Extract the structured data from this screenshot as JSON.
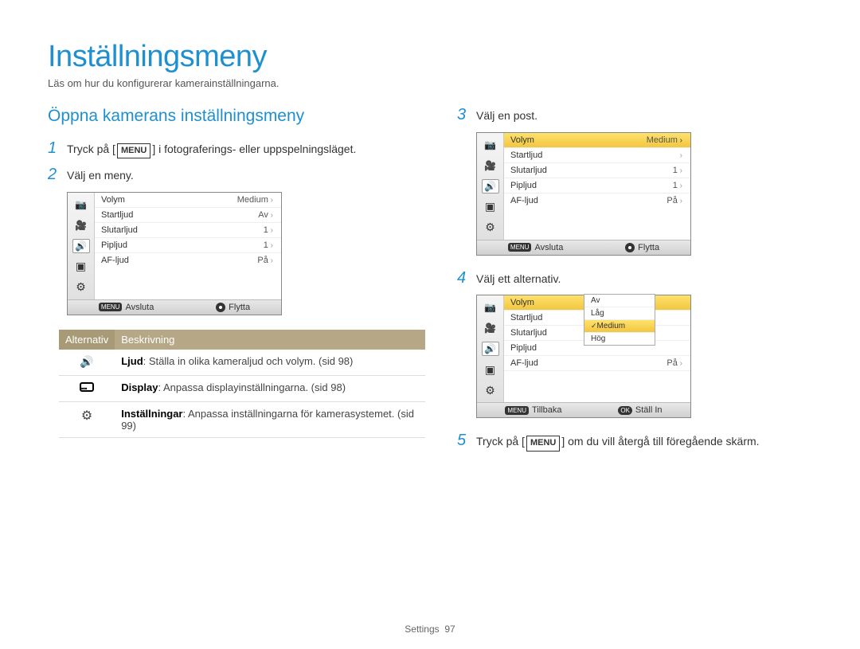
{
  "page": {
    "title": "Inställningsmeny",
    "subtitle": "Läs om hur du konfigurerar kamerainställningarna."
  },
  "section": {
    "heading": "Öppna kamerans inställningsmeny"
  },
  "steps": {
    "s1_pre": "Tryck på [",
    "s1_menu": "MENU",
    "s1_post": "] i fotograferings- eller uppspelningsläget.",
    "s2": "Välj en meny.",
    "s3": "Välj en post.",
    "s4": "Välj ett alternativ.",
    "s5_pre": "Tryck på [",
    "s5_menu": "MENU",
    "s5_post": "] om du vill återgå till föregående skärm."
  },
  "nums": {
    "n1": "1",
    "n2": "2",
    "n3": "3",
    "n4": "4",
    "n5": "5"
  },
  "lcd": {
    "rows": {
      "volym": "Volym",
      "startljud": "Startljud",
      "slutarljud": "Slutarljud",
      "pipljud": "Pipljud",
      "afljud": "AF-ljud"
    },
    "vals2": {
      "volym": "Medium",
      "startljud": "Av",
      "slutarljud": "1",
      "pipljud": "1",
      "afljud": "På"
    },
    "vals3": {
      "volym": "Medium",
      "startljud": "",
      "slutarljud": "1",
      "pipljud": "1",
      "afljud": "På"
    },
    "vals4": {
      "volym": "",
      "startljud": "",
      "slutarljud": "",
      "pipljud": "",
      "afljud": "På"
    },
    "foot": {
      "avsluta": "Avsluta",
      "flytta": "Flytta",
      "tillbaka": "Tillbaka",
      "stallin": "Ställ In",
      "menubtn": "MENU",
      "okbtn": "OK"
    }
  },
  "popup": {
    "av": "Av",
    "lag": "Låg",
    "medium": "Medium",
    "hog": "Hög"
  },
  "table": {
    "h1": "Alternativ",
    "h2": "Beskrivning",
    "r1b": "Ljud",
    "r1": ": Ställa in olika kameraljud och volym. (sid 98)",
    "r2b": "Display",
    "r2": ": Anpassa displayinställningarna. (sid 98)",
    "r3b": "Inställningar",
    "r3": ": Anpassa inställningarna för kamerasystemet. (sid 99)"
  },
  "footer": {
    "label": "Settings",
    "page": "97"
  }
}
